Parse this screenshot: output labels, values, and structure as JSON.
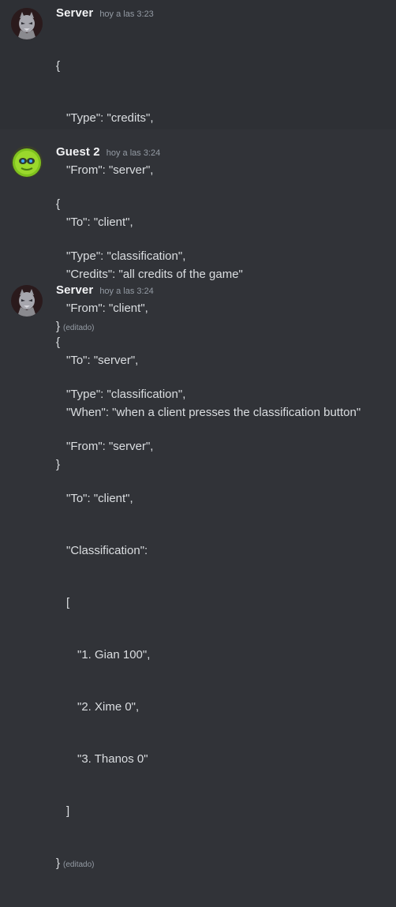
{
  "messages": [
    {
      "username": "Server",
      "timestamp": "hoy a las 3:23",
      "avatar_icon": "server-avatar-icon",
      "lines": [
        "{",
        "\"Type\": \"credits\",",
        "\"From\": \"server\",",
        "\"To\": \"client\",",
        "\"Credits\": \"all credits of the game\"",
        "}"
      ],
      "edited": "(editado)"
    },
    {
      "username": "Guest  2",
      "timestamp": "hoy a las 3:24",
      "avatar_icon": "guest-avatar-icon",
      "lines": [
        "{",
        "\"Type\": \"classification\",",
        "\"From\": \"client\",",
        "\"To\": \"server\",",
        "\"When\": \"when a client presses the classification button\"",
        "}"
      ]
    },
    {
      "username": "Server",
      "timestamp": "hoy a las 3:24",
      "avatar_icon": "server-avatar-icon",
      "lines": [
        "{",
        "\"Type\": \"classification\",",
        "\"From\": \"server\",",
        "\"To\": \"client\",",
        "\"Classification\":",
        "[",
        "\"1. Gian 100\",",
        "\"2. Xime 0\",",
        "\"3. Thanos 0\"",
        "]",
        "}"
      ],
      "edited": "(editado)"
    }
  ],
  "colors": {
    "background": "#313338",
    "hover_background": "#2e3035",
    "username": "#f2f3f5",
    "text": "#dbdee1",
    "muted": "#949ba4"
  }
}
